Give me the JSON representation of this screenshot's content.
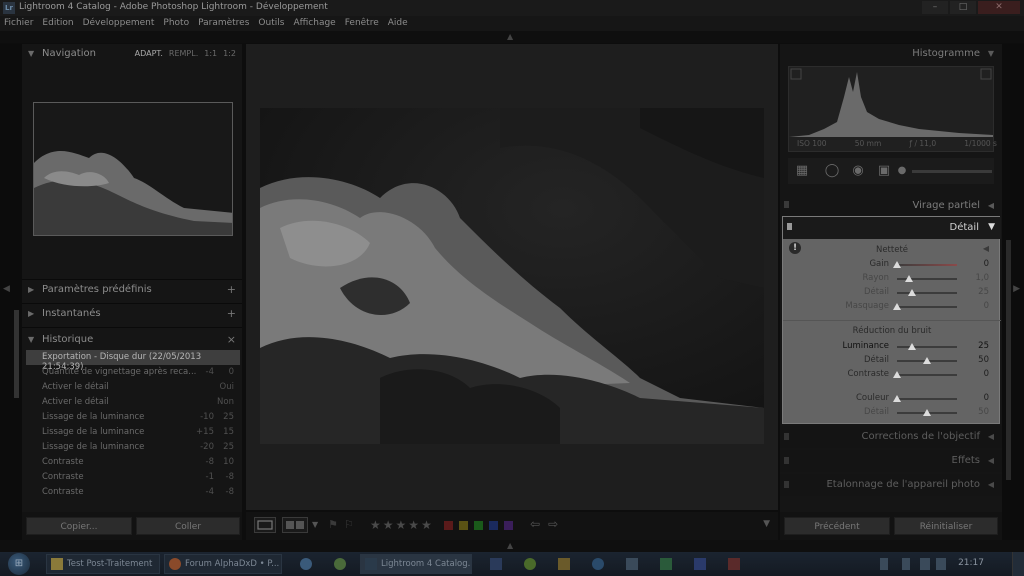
{
  "window": {
    "app_icon": "Lr",
    "title": "Lightroom 4 Catalog - Adobe Photoshop Lightroom - Développement",
    "controls": [
      "–",
      "□",
      "✕"
    ]
  },
  "menu": [
    "Fichier",
    "Edition",
    "Développement",
    "Photo",
    "Paramètres",
    "Outils",
    "Affichage",
    "Fenêtre",
    "Aide"
  ],
  "left_panel": {
    "navigation": {
      "title": "Navigation",
      "options": [
        "ADAPT.",
        "REMPL.",
        "1:1",
        "1:2"
      ]
    },
    "presets": {
      "title": "Paramètres prédéfinis"
    },
    "snapshots": {
      "title": "Instantanés"
    },
    "history": {
      "title": "Historique",
      "close": "×",
      "items": [
        {
          "name": "Exportation - Disque dur (22/05/2013 21:54:39)",
          "from": "",
          "to": ""
        },
        {
          "name": "Quantité de vignettage après reca...",
          "from": "-4",
          "to": "0"
        },
        {
          "name": "Activer le détail",
          "from": "",
          "to": "Oui"
        },
        {
          "name": "Activer le détail",
          "from": "",
          "to": "Non"
        },
        {
          "name": "Lissage de la luminance",
          "from": "-10",
          "to": "25"
        },
        {
          "name": "Lissage de la luminance",
          "from": "+15",
          "to": "15"
        },
        {
          "name": "Lissage de la luminance",
          "from": "-20",
          "to": "25"
        },
        {
          "name": "Contraste",
          "from": "-8",
          "to": "10"
        },
        {
          "name": "Contraste",
          "from": "-1",
          "to": "-8"
        },
        {
          "name": "Contraste",
          "from": "-4",
          "to": "-8"
        }
      ]
    },
    "buttons": {
      "copy": "Copier...",
      "paste": "Coller"
    }
  },
  "toolbar": {
    "stars": [
      "★",
      "★",
      "★",
      "★",
      "★"
    ],
    "labels": [
      "#a02020",
      "#b0a020",
      "#30a030",
      "#2040b0",
      "#6a30a0"
    ],
    "prev": "⇦",
    "next": "⇨",
    "menu": "▼"
  },
  "right_panel": {
    "histogram": {
      "title": "Histogramme",
      "info": {
        "iso": "ISO 100",
        "focal": "50 mm",
        "aperture": "ƒ / 11,0",
        "shutter": "1/1000 s"
      }
    },
    "split_toning": {
      "title": "Virage partiel"
    },
    "detail": {
      "title": "Détail",
      "warning": "!",
      "sharpening": {
        "title": "Netteté",
        "rows": [
          {
            "label": "Gain",
            "value": "0",
            "pos": 0.0,
            "red": true
          },
          {
            "label": "Rayon",
            "value": "1,0",
            "pos": 0.2,
            "red": false
          },
          {
            "label": "Détail",
            "value": "25",
            "pos": 0.25,
            "red": false
          },
          {
            "label": "Masquage",
            "value": "0",
            "pos": 0.0,
            "red": false
          }
        ]
      },
      "noise": {
        "title": "Réduction du bruit",
        "rows": [
          {
            "label": "Luminance",
            "value": "25",
            "pos": 0.25
          },
          {
            "label": "Détail",
            "value": "50",
            "pos": 0.5
          },
          {
            "label": "Contraste",
            "value": "0",
            "pos": 0.0
          },
          {
            "label": "Couleur",
            "value": "0",
            "pos": 0.0
          },
          {
            "label": "Détail",
            "value": "50",
            "pos": 0.5
          }
        ]
      }
    },
    "lens": {
      "title": "Corrections de l'objectif"
    },
    "effects": {
      "title": "Effets"
    },
    "camera": {
      "title": "Etalonnage de l'appareil photo"
    },
    "buttons": {
      "previous": "Précédent",
      "reset": "Réinitialiser"
    }
  },
  "taskbar": {
    "tasks": [
      "Test Post-Traitement",
      "Forum AlphaDxD • P...",
      "Lightroom 4 Catalog..."
    ],
    "clock": "21:17"
  }
}
